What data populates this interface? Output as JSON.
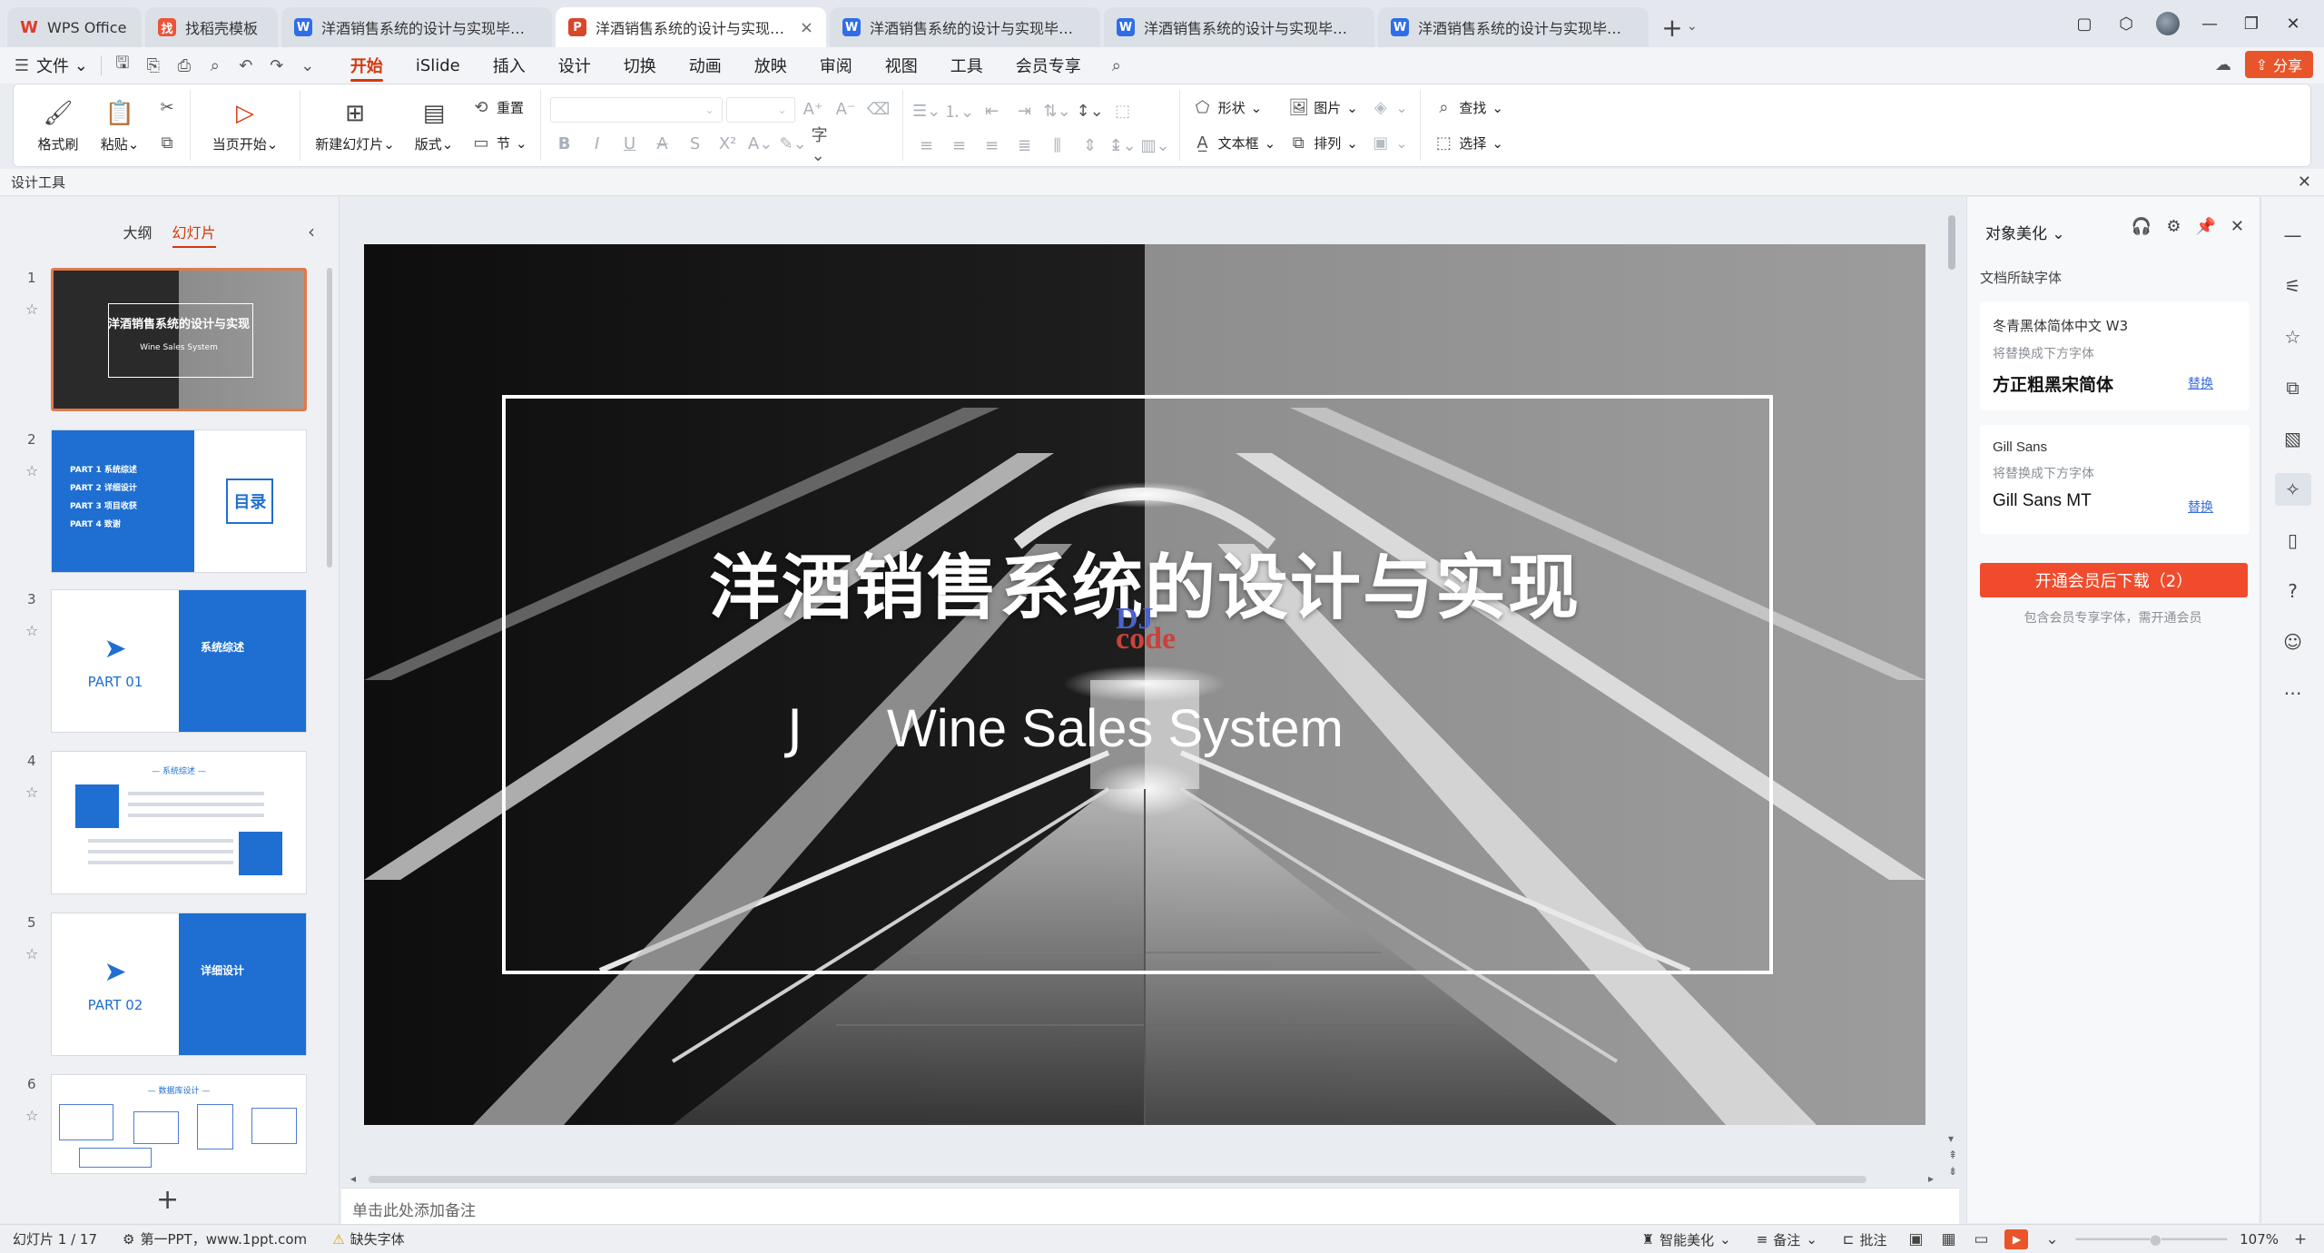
{
  "tabs": [
    {
      "label": "WPS Office",
      "icon": "wps-logo-icon",
      "active": false
    },
    {
      "label": "找稻壳模板",
      "icon": "docer-icon",
      "active": false
    },
    {
      "label": "洋酒销售系统的设计与实现毕设任务书",
      "icon": "word-doc-icon",
      "active": false
    },
    {
      "label": "洋酒销售系统的设计与实现毕业答辩",
      "icon": "ppt-doc-icon",
      "active": true
    },
    {
      "label": "洋酒销售系统的设计与实现毕业设计说明书",
      "icon": "word-doc-icon",
      "active": false
    },
    {
      "label": "洋酒销售系统的设计与实现毕业设计中",
      "icon": "word-doc-icon",
      "active": false
    },
    {
      "label": "洋酒销售系统的设计与实现毕业设计",
      "icon": "word-doc-icon",
      "active": false
    }
  ],
  "menu": {
    "file_label": "文件",
    "items": [
      "开始",
      "iSlide",
      "插入",
      "设计",
      "切换",
      "动画",
      "放映",
      "审阅",
      "视图",
      "工具",
      "会员专享"
    ],
    "active": "开始",
    "share_label": "分享"
  },
  "ribbon": {
    "format_painter": "格式刷",
    "paste": "粘贴",
    "play_from_current": "当页开始",
    "new_slide": "新建幻灯片",
    "layout": "版式",
    "reset": "重置",
    "section": "节",
    "shape": "形状",
    "picture": "图片",
    "textbox": "文本框",
    "arrange": "排列",
    "find": "查找",
    "select": "选择"
  },
  "design_tools_label": "设计工具",
  "left_panel": {
    "tab_outline": "大纲",
    "tab_slides": "幻灯片",
    "thumbs": [
      {
        "num": "1",
        "title": "洋酒销售系统的设计与实现",
        "sub": "Wine Sales System"
      },
      {
        "num": "2",
        "items": [
          "PART 1 系统综述",
          "PART 2 详细设计",
          "PART 3 项目收获",
          "PART 4 致谢"
        ],
        "box": "目录"
      },
      {
        "num": "3",
        "left": "PART 01",
        "right": "系统综述"
      },
      {
        "num": "4",
        "header": "— 系统综述 —"
      },
      {
        "num": "5",
        "left": "PART 02",
        "right": "详细设计"
      },
      {
        "num": "6",
        "header": "— 数据库设计 —"
      }
    ]
  },
  "slide": {
    "title": "洋酒销售系统的设计与实现",
    "subtitle_prefix": "J",
    "subtitle": "Wine Sales System",
    "watermark_top": "DJ",
    "watermark_bottom": "code"
  },
  "notes_placeholder": "单击此处添加备注",
  "right_panel": {
    "title": "对象美化",
    "missing_fonts_label": "文档所缺字体",
    "fonts": [
      {
        "original": "冬青黑体简体中文 W3",
        "hint": "将替换成下方字体",
        "replacement": "方正粗黑宋简体",
        "action": "替换"
      },
      {
        "original": "Gill Sans",
        "hint": "将替换成下方字体",
        "replacement": "Gill Sans MT",
        "action": "替换"
      }
    ],
    "vip_button": "开通会员后下载（2）",
    "vip_note": "包含会员专享字体，需开通会员"
  },
  "status": {
    "slide_counter": "幻灯片 1 / 17",
    "theme": "第一PPT，www.1ppt.com",
    "missing_font": "缺失字体",
    "smart_beautify": "智能美化",
    "notes": "备注",
    "comments": "批注",
    "zoom": "107%"
  },
  "colors": {
    "accent": "#d4380d",
    "share": "#e8552a",
    "vip": "#ef4b2c",
    "thumb_blue": "#1e6fd1"
  }
}
